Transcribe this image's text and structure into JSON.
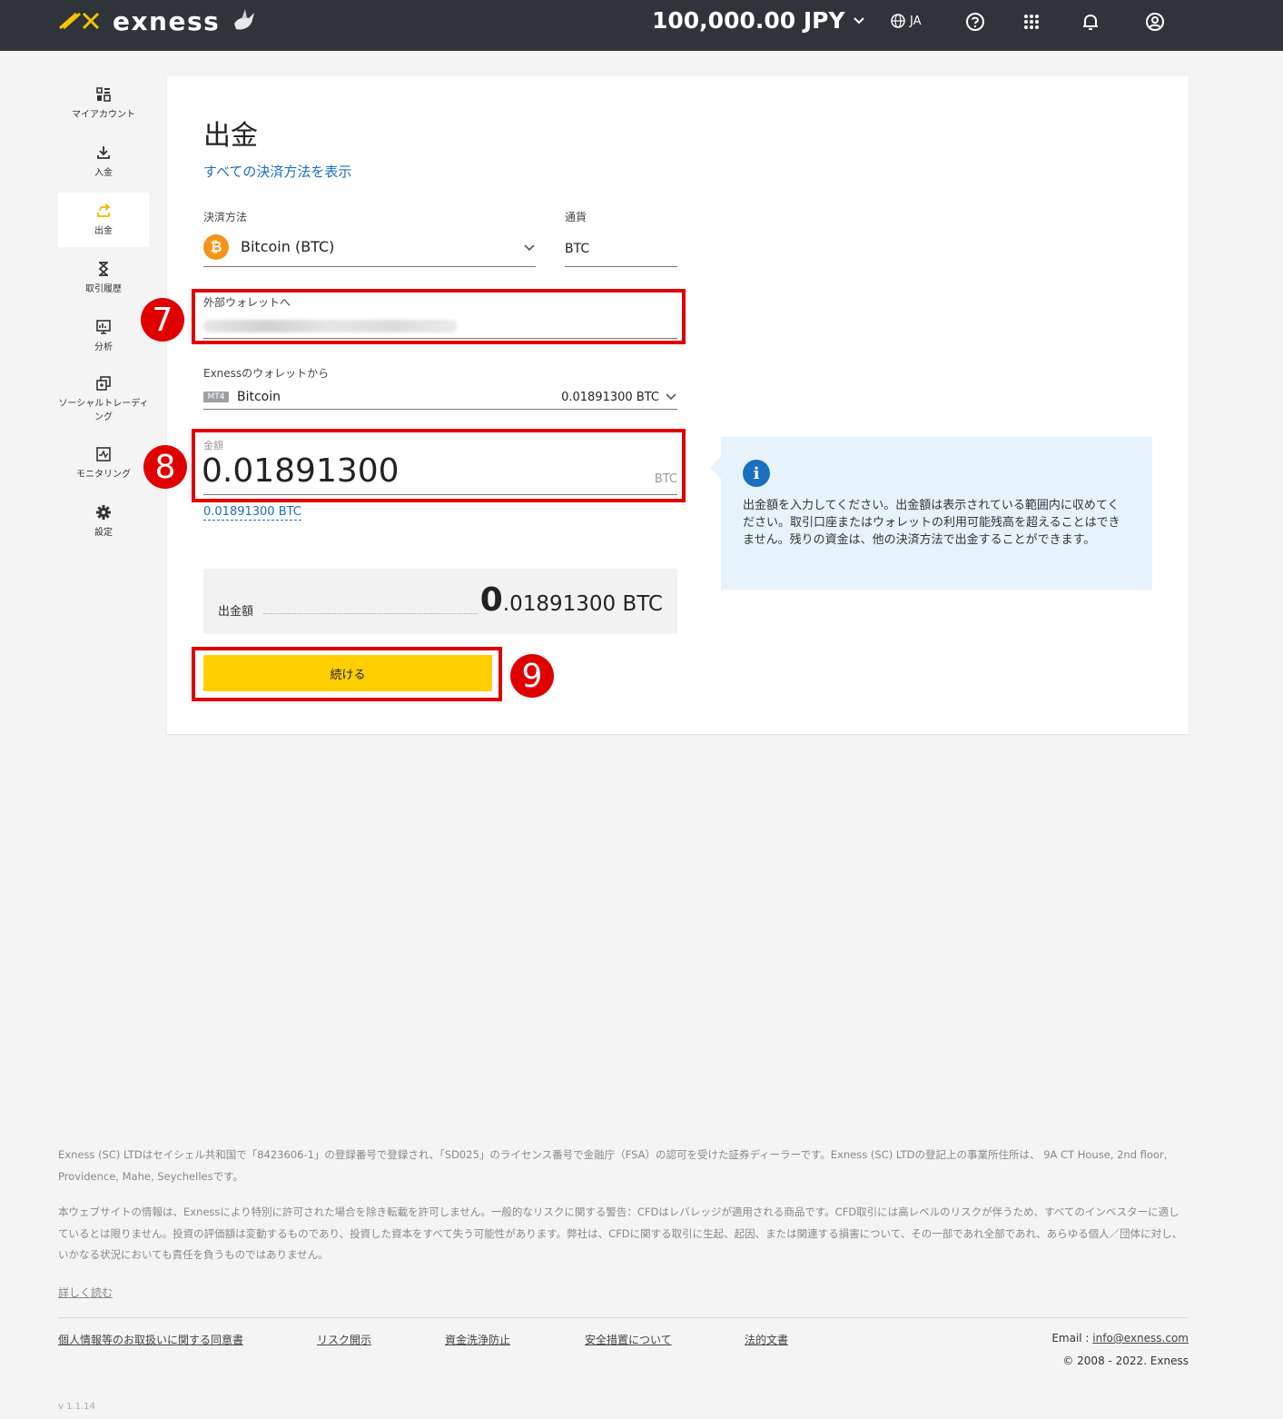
{
  "header": {
    "logo_text": "exness",
    "balance": "100,000.00 JPY",
    "language": "JA"
  },
  "sidebar": {
    "items": [
      {
        "label": "マイアカウント",
        "icon": "dashboard-icon"
      },
      {
        "label": "入金",
        "icon": "download-icon"
      },
      {
        "label": "出金",
        "icon": "upload-icon",
        "active": true
      },
      {
        "label": "取引履歴",
        "icon": "hourglass-icon"
      },
      {
        "label": "分析",
        "icon": "chart-icon"
      },
      {
        "label": "ソーシャルトレーディング",
        "icon": "copy-icon"
      },
      {
        "label": "モニタリング",
        "icon": "monitor-icon"
      },
      {
        "label": "設定",
        "icon": "gear-icon"
      }
    ]
  },
  "main": {
    "title": "出金",
    "show_all_methods": "すべての決済方法を表示",
    "payment_method_label": "決済方法",
    "payment_method_value": "Bitcoin (BTC)",
    "currency_label": "通貨",
    "currency_value": "BTC",
    "external_wallet_label": "外部ウォレットへ",
    "from_wallet_label": "Exnessのウォレットから",
    "wallet_badge": "MT4",
    "wallet_name": "Bitcoin",
    "wallet_balance": "0.01891300 BTC",
    "amount_label": "金額",
    "amount_value": "0.01891300",
    "amount_unit": "BTC",
    "max_amount_link": "0.01891300  BTC",
    "summary_label": "出金額",
    "summary_int": "0",
    "summary_rest": ".01891300 BTC",
    "continue_button": "続ける",
    "steps": [
      "7",
      "8",
      "9"
    ],
    "info_text": "出金額を入力してください。出金額は表示されている範囲内に収めてください。取引口座またはウォレットの利用可能残高を超えることはできません。残りの資金は、他の決済方法で出金することができます。"
  },
  "footer": {
    "legal_1": "Exness (SC) LTDはセイシェル共和国で「8423606-1」の登録番号で登録され、「SD025」のライセンス番号で金融庁（FSA）の認可を受けた証券ディーラーです。Exness (SC) LTDの登記上の事業所住所は、 9A CT House, 2nd floor, Providence, Mahe, Seychellesです。",
    "legal_2": "本ウェブサイトの情報は、Exnessにより特別に許可された場合を除き転載を許可しません。一般的なリスクに関する警告：CFDはレバレッジが適用される商品です。CFD取引には高レベルのリスクが伴うため、すべてのインベスターに適しているとは限りません。投資の評価額は変動するものであり、投資した資本をすべて失う可能性があります。弊社は、CFDに関する取引に生起、起因、または関連する損害について、その一部であれ全部であれ、あらゆる個人／団体に対し、いかなる状況においても責任を負うものではありません。",
    "read_more": "詳しく読む",
    "links": [
      "個人情報等のお取扱いに関する同意書",
      "リスク開示",
      "資金洗浄防止",
      "安全措置について",
      "法的文書"
    ],
    "email_label": "Email : ",
    "email": "info@exness.com",
    "copyright": "© 2008 - 2022. Exness",
    "version": "v 1.1.14"
  },
  "colors": {
    "header_bg": "#2f3439",
    "accent_yellow": "#ffcf00",
    "link_blue": "#1a6fbe",
    "highlight_red": "#e00000",
    "bitcoin_orange": "#f7931a",
    "info_bg": "#e6f3fc"
  }
}
